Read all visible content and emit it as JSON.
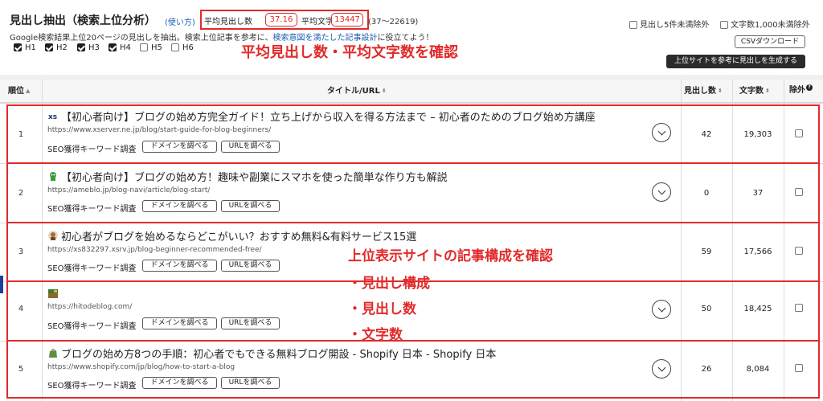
{
  "header": {
    "title": "見出し抽出（検索上位分析）",
    "help_link": "(使い方)",
    "avg_headings_label": "平均見出し数",
    "avg_headings_value": "37.16",
    "avg_chars_label": "平均文字数",
    "avg_chars_value": "13447",
    "range": "(37〜22619)",
    "desc_prefix": "Google検索結果上位20ページの見出しを抽出。検索上位記事を参考に、",
    "desc_link": "検索意図を満たした記事設計",
    "desc_suffix": "に役立てよう！",
    "heading_filters": [
      {
        "label": "H1",
        "checked": true
      },
      {
        "label": "H2",
        "checked": true
      },
      {
        "label": "H3",
        "checked": true
      },
      {
        "label": "H4",
        "checked": true
      },
      {
        "label": "H5",
        "checked": false
      },
      {
        "label": "H6",
        "checked": false
      }
    ],
    "option_min_headings": "見出し5件未満除外",
    "option_min_chars": "文字数1,000未満除外",
    "csv_button": "CSVダウンロード",
    "generate_button": "上位サイトを参考に見出しを生成する"
  },
  "annotations": {
    "top": "平均見出し数・平均文字数を確認",
    "middle_title": "上位表示サイトの記事構成を確認",
    "bullets": [
      "・見出し構成",
      "・見出し数",
      "・文字数"
    ]
  },
  "table": {
    "columns": {
      "rank": "順位",
      "title_url": "タイトル/URL",
      "headings": "見出し数",
      "chars": "文字数",
      "exclude": "除外"
    },
    "seo_label": "SEO獲得キーワード調査",
    "domain_button": "ドメインを調べる",
    "url_button": "URLを調べる",
    "rows": [
      {
        "rank": "1",
        "favicon": "xserver-icon",
        "title": "【初心者向け】ブログの始め方完全ガイド！立ち上げから収入を得る方法まで – 初心者のためのブログ始め方講座",
        "url": "https://www.xserver.ne.jp/blog/start-guide-for-blog-beginners/",
        "headings": "42",
        "chars": "19,303"
      },
      {
        "rank": "2",
        "favicon": "ameblo-icon",
        "title": "【初心者向け】ブログの始め方！趣味や副業にスマホを使った簡単な作り方も解説",
        "url": "https://ameblo.jp/blog-navi/article/blog-start/",
        "headings": "0",
        "chars": "37"
      },
      {
        "rank": "3",
        "favicon": "avatar-icon",
        "title": "初心者がブログを始めるならどこがいい？おすすめ無料&有料サービス15選",
        "url": "https://xs832297.xsrv.jp/blog-beginner-recommended-free/",
        "headings": "59",
        "chars": "17,566"
      },
      {
        "rank": "4",
        "favicon": "hitodeblog-icon",
        "title": "",
        "url": "https://hitodeblog.com/",
        "headings": "50",
        "chars": "18,425"
      },
      {
        "rank": "5",
        "favicon": "shopify-icon",
        "title": "ブログの始め方8つの手順：初心者でもできる無料ブログ開設 - Shopify 日本 - Shopify 日本",
        "url": "https://www.shopify.com/jp/blog/how-to-start-a-blog",
        "headings": "26",
        "chars": "8,084"
      }
    ]
  }
}
